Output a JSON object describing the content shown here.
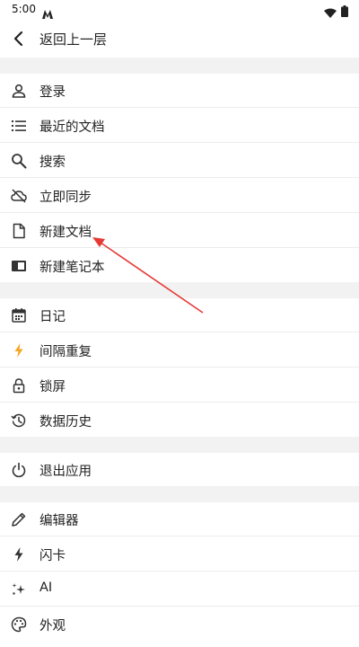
{
  "status_bar": {
    "time": "5:00"
  },
  "header": {
    "back_label": "返回上一层"
  },
  "menu": {
    "items": [
      {
        "label": "登录",
        "icon": "person-icon"
      },
      {
        "label": "最近的文档",
        "icon": "list-icon"
      },
      {
        "label": "搜索",
        "icon": "search-icon"
      },
      {
        "label": "立即同步",
        "icon": "cloud-off-icon"
      },
      {
        "label": "新建文档",
        "icon": "document-icon"
      },
      {
        "label": "新建笔记本",
        "icon": "notebook-icon"
      },
      {
        "label": "日记",
        "icon": "calendar-icon"
      },
      {
        "label": "间隔重复",
        "icon": "lightning-icon"
      },
      {
        "label": "锁屏",
        "icon": "lock-icon"
      },
      {
        "label": "数据历史",
        "icon": "history-icon"
      },
      {
        "label": "退出应用",
        "icon": "power-icon"
      },
      {
        "label": "编辑器",
        "icon": "pencil-icon"
      },
      {
        "label": "闪卡",
        "icon": "flash-icon"
      },
      {
        "label": "AI",
        "icon": "sparkle-icon"
      },
      {
        "label": "外观",
        "icon": "palette-icon"
      }
    ]
  },
  "colors": {
    "section_divider": "#f2f2f2",
    "annotation_arrow": "#e53935",
    "lightning_accent": "#f5a623"
  }
}
